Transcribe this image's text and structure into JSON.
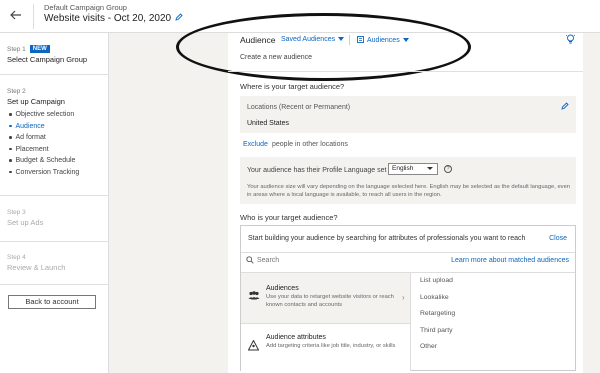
{
  "header": {
    "group": "Default Campaign Group",
    "title": "Website visits - Oct 20, 2020"
  },
  "sidebar": {
    "step1": {
      "num": "Step 1",
      "badge": "NEW",
      "name": "Select Campaign Group"
    },
    "step2": {
      "num": "Step 2",
      "name": "Set up Campaign",
      "items": [
        {
          "label": "Objective selection"
        },
        {
          "label": "Audience"
        },
        {
          "label": "Ad format"
        },
        {
          "label": "Placement"
        },
        {
          "label": "Budget & Schedule"
        },
        {
          "label": "Conversion Tracking"
        }
      ]
    },
    "step3": {
      "num": "Step 3",
      "name": "Set up Ads"
    },
    "step4": {
      "num": "Step 4",
      "name": "Review & Launch"
    },
    "back_button": "Back to account"
  },
  "main": {
    "audience_label": "Audience",
    "saved_audiences": "Saved Audiences",
    "audiences_dropdown": "Audiences",
    "create_new": "Create a new audience",
    "where_title": "Where is your target audience?",
    "locations_label": "Locations (Recent or Permanent)",
    "locations_value": "United States",
    "exclude_link": "Exclude",
    "exclude_note": "people in other locations",
    "language_question": "Your audience has their Profile Language set to",
    "language_value": "English",
    "language_note": "Your audience size will vary depending on the language selected here. English may be selected as the default language, even in areas where a local language is available, to reach all users in the region.",
    "who_title": "Who is your target audience?",
    "build_prompt": "Start building your audience by searching for attributes of professionals you want to reach",
    "close_link": "Close",
    "search_placeholder": "Search",
    "learn_more": "Learn more about matched audiences",
    "options": {
      "audiences": {
        "title": "Audiences",
        "desc": "Use your data to retarget website visitors or reach known contacts and accounts"
      },
      "attributes": {
        "title": "Audience attributes",
        "desc": "Add targeting criteria like job title, industry, or skills"
      }
    },
    "sublist": [
      "List upload",
      "Lookalike",
      "Retargeting",
      "Third party",
      "Other"
    ]
  },
  "colors": {
    "accent": "#0a66c2",
    "background": "#f3f2ef"
  },
  "icons": [
    "back-arrow-icon",
    "pencil-icon",
    "lightbulb-icon",
    "search-icon",
    "people-icon",
    "person-attributes-icon",
    "chevron-right-icon",
    "help-icon"
  ]
}
